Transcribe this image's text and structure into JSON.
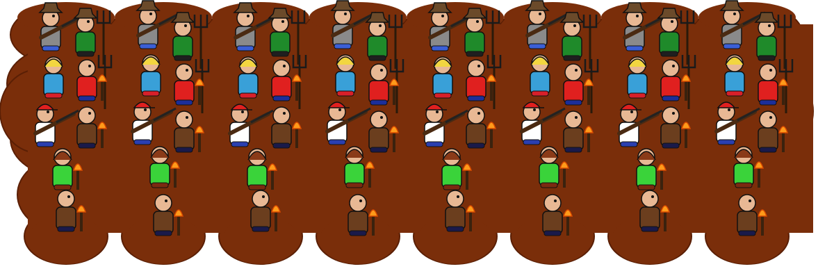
{
  "sprite_sheet": {
    "background": "#ffffff",
    "mud_color": "#7a2e0a",
    "mud_edge": "#5a1f05",
    "frame_count": 8,
    "rows_per_frame": [
      "leaders",
      "villagers",
      "gunners",
      "torchbearers",
      "stragglers"
    ]
  },
  "characters": [
    {
      "role": "bearded-rifleman",
      "hat": "brown-hat",
      "shirt": "#8a8a8a",
      "accent": "#3b5fd6",
      "weapon": "rifle"
    },
    {
      "role": "green-vest-farmer",
      "hat": "brown-hat",
      "shirt": "#1f8a2a",
      "accent": "#1f1f1f",
      "weapon": "pitchfork"
    },
    {
      "role": "blonde-woman",
      "hat": "none",
      "shirt": "#39a0d8",
      "accent": "#d8202a",
      "weapon": "none"
    },
    {
      "role": "red-shirt-farmer",
      "hat": "none",
      "shirt": "#e0201f",
      "accent": "#1c2e9a",
      "weapon": "pitchfork-and-torch"
    },
    {
      "role": "red-cap-gunner",
      "hat": "red-cap",
      "shirt": "#ffffff",
      "accent": "#2a3fb0",
      "weapon": "rifle"
    },
    {
      "role": "bald-old-man",
      "hat": "none",
      "shirt": "#6b3e1e",
      "accent": "#1a1a4a",
      "weapon": "torch"
    },
    {
      "role": "green-dress-girl",
      "hat": "none",
      "shirt": "#3ad33a",
      "accent": "#7a2a10",
      "weapon": "torch"
    }
  ]
}
